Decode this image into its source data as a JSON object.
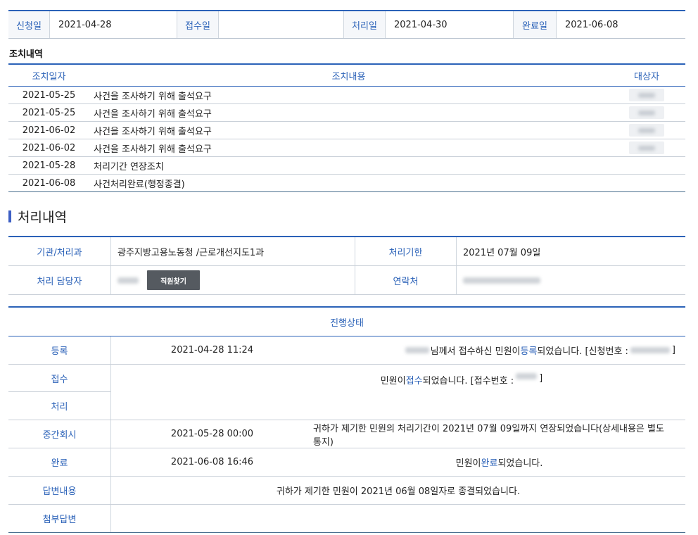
{
  "dates": {
    "apply_label": "신청일",
    "apply_value": "2021-04-28",
    "receive_label": "접수일",
    "receive_value": "",
    "process_label": "처리일",
    "process_value": "2021-04-30",
    "complete_label": "완료일",
    "complete_value": "2021-06-08"
  },
  "actions": {
    "title": "조치내역",
    "headers": {
      "date": "조치일자",
      "content": "조치내용",
      "target": "대상자"
    },
    "rows": [
      {
        "date": "2021-05-25",
        "content": "사건을 조사하기 위해 출석요구"
      },
      {
        "date": "2021-05-25",
        "content": "사건을 조사하기 위해 출석요구"
      },
      {
        "date": "2021-06-02",
        "content": "사건을 조사하기 위해 출석요구"
      },
      {
        "date": "2021-06-02",
        "content": "사건을 조사하기 위해 출석요구"
      },
      {
        "date": "2021-05-28",
        "content": "처리기간 연장조치"
      },
      {
        "date": "2021-06-08",
        "content": "사건처리완료(행정종결)"
      }
    ]
  },
  "processing": {
    "title": "처리내역",
    "org_label": "기관/처리과",
    "org_value": "광주지방고용노동청 /근로개선지도1과",
    "deadline_label": "처리기한",
    "deadline_value": "2021년 07월 09일",
    "staff_label": "처리 담당자",
    "find_staff_button": "직원찾기",
    "contact_label": "연락처"
  },
  "progress": {
    "title": "진행상태",
    "register": {
      "label": "등록",
      "datetime": "2021-04-28 11:24",
      "msg_a": "님께서 접수하신 민원이 ",
      "msg_highlight": "등록",
      "msg_b": "되었습니다. [신청번호 : ",
      "msg_end": " ]"
    },
    "receive": {
      "label": "접수",
      "msg_a": "민원이 ",
      "msg_highlight": "접수",
      "msg_b": "되었습니다. [접수번호 : ",
      "msg_end": " ]"
    },
    "process": {
      "label": "처리"
    },
    "interim": {
      "label": "중간회시",
      "datetime": "2021-05-28 00:00",
      "msg": "귀하가 제기한 민원의 처리기간이 2021년 07월 09일까지 연장되었습니다(상세내용은 별도 통지)"
    },
    "complete": {
      "label": "완료",
      "datetime": "2021-06-08 16:46",
      "msg_a": "민원이 ",
      "msg_highlight": "완료",
      "msg_b": " 되었습니다."
    },
    "answer": {
      "label": "답변내용",
      "msg": "귀하가 제기한 민원이 2021년 06월 08일자로 종결되었습니다."
    },
    "attachment": {
      "label": "첨부답변"
    }
  }
}
